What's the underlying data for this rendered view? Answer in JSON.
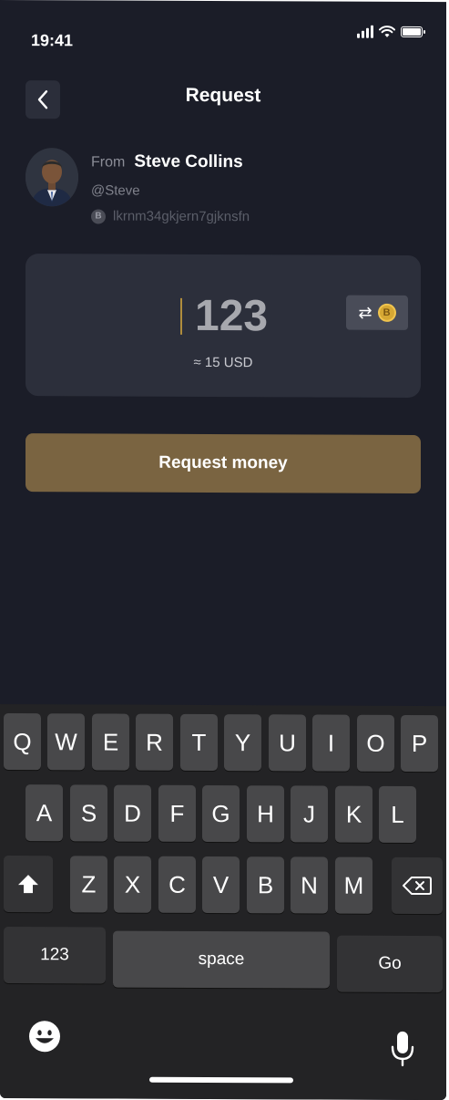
{
  "status": {
    "time": "19:41"
  },
  "header": {
    "title": "Request"
  },
  "sender": {
    "from_label": "From",
    "name": "Steve Collins",
    "handle": "@Steve",
    "coin_symbol": "B",
    "address": "lkrnm34gkjern7gjknsfn"
  },
  "amount": {
    "value": "123",
    "approx": "≈ 15 USD",
    "swap_icon": "⇄",
    "coin_symbol": "B"
  },
  "actions": {
    "request_label": "Request money"
  },
  "keyboard": {
    "row1": [
      "Q",
      "W",
      "E",
      "R",
      "T",
      "Y",
      "U",
      "I",
      "O",
      "P"
    ],
    "row2": [
      "A",
      "S",
      "D",
      "F",
      "G",
      "H",
      "J",
      "K",
      "L"
    ],
    "row3": [
      "Z",
      "X",
      "C",
      "V",
      "B",
      "N",
      "M"
    ],
    "numbers_label": "123",
    "space_label": "space",
    "go_label": "Go"
  },
  "icons": {
    "back": "chevron-left-icon",
    "signal": "signal-icon",
    "wifi": "wifi-icon",
    "battery": "battery-icon",
    "shift": "shift-icon",
    "backspace": "backspace-icon",
    "emoji": "emoji-icon",
    "microphone": "microphone-icon"
  },
  "colors": {
    "accent": "#7a6441",
    "background": "#1b1d28",
    "card": "#2c2f3b",
    "caret": "#b08d3c"
  }
}
